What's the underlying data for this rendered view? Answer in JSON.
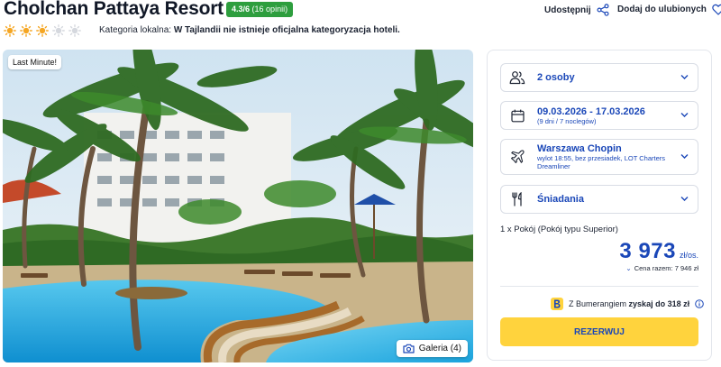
{
  "header": {
    "title": "Cholchan Pattaya Resort",
    "rating": "4.3/6",
    "rating_count": "(16 opinii)",
    "stars_filled": 3,
    "stars_total": 5,
    "category_label": "Kategoria lokalna:",
    "category_text": "W Tajlandii nie istnieje oficjalna kategoryzacja hoteli.",
    "share_label": "Udostępnij",
    "favorite_label": "Dodaj do ulubionych"
  },
  "photo": {
    "badge": "Last Minute!",
    "gallery_label": "Galeria (4)"
  },
  "booking": {
    "persons": "2 osoby",
    "dates": "09.03.2026 - 17.03.2026",
    "dates_sub": "(9 dni / 7 noclegów)",
    "departure": "Warszawa Chopin",
    "departure_sub": "wylot 18:55, bez przesiadek, LOT Charters Dreamliner",
    "board": "Śniadania",
    "room": "1 x Pokój  (Pokój typu Superior)",
    "price": "3 973",
    "price_unit": "zł/os.",
    "total": "Cena razem: 7 946 zł",
    "bumerang_prefix": "Z Bumerangiem",
    "bumerang_bold": "zyskaj do 318 zł",
    "reserve_label": "REZERWUJ"
  },
  "colors": {
    "accent": "#1a47b8",
    "rating_green": "#2e9e3e",
    "reserve_yellow": "#ffd33d",
    "sun_orange": "#f5a623"
  }
}
